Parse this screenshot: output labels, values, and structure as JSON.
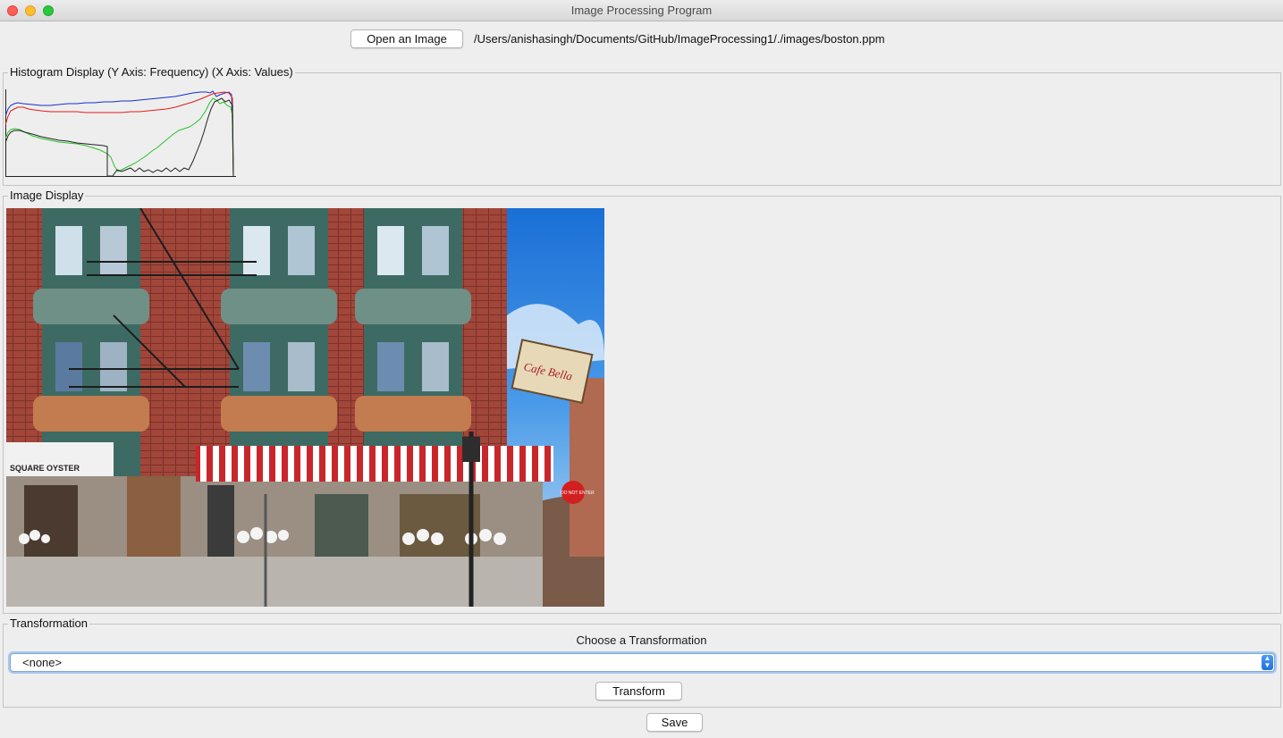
{
  "window": {
    "title": "Image Processing Program"
  },
  "toolbar": {
    "open_label": "Open an Image",
    "file_path": "/Users/anishasingh/Documents/GitHub/ImageProcessing1/./images/boston.ppm"
  },
  "histogram_panel": {
    "title": "Histogram Display (Y Axis: Frequency) (X Axis: Values)",
    "series_colors": {
      "red": "#e21b1b",
      "green": "#29c229",
      "blue": "#1530c8",
      "intensity": "#222222"
    }
  },
  "image_panel": {
    "title": "Image Display",
    "image_text": {
      "left_sign": "SQUARE OYSTER",
      "hanging_sign": "Cafe Bella",
      "do_not_enter": "DO NOT ENTER"
    }
  },
  "transform_panel": {
    "title": "Transformation",
    "choose_label": "Choose a Transformation",
    "selected": "<none>",
    "transform_label": "Transform"
  },
  "footer": {
    "save_label": "Save"
  }
}
